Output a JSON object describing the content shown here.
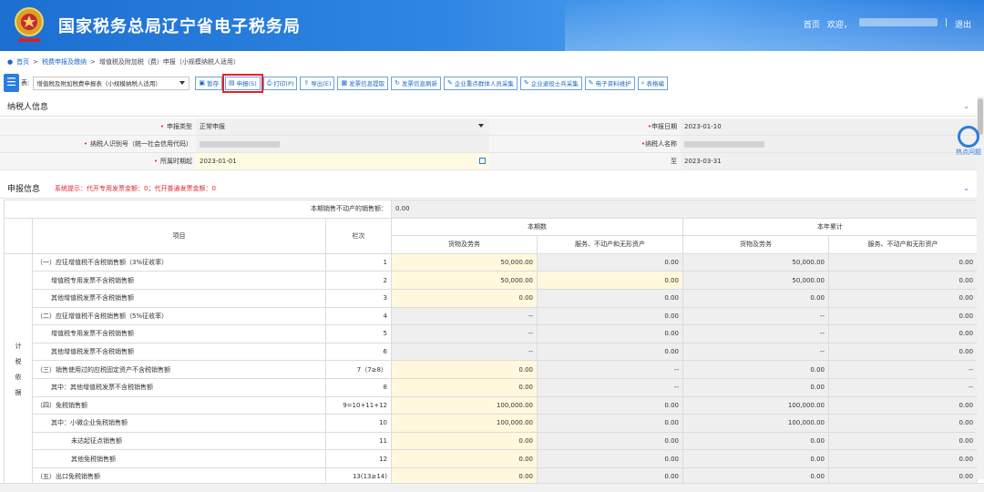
{
  "header": {
    "title": "国家税务总局辽宁省电子税务局",
    "nav": [
      "首页",
      "欢迎，",
      "|",
      "退出"
    ]
  },
  "breadcrumb": [
    "首页",
    "税费申报及缴纳",
    "增值税及附加税（费）申报（小规模纳税人适用）"
  ],
  "toolbar": {
    "label": "表:",
    "select_value": "增值税及附加税费申报表（小规模纳税人适用）",
    "buttons": [
      "暂存",
      "申报(S)",
      "打印(P)",
      "导出(E)",
      "发票信息提取",
      "发票信息刷新",
      "企业重点群体人员采集",
      "企业退役士兵采集",
      "电子资料维护",
      "表格编"
    ]
  },
  "taxpayer": {
    "title": "纳税人信息",
    "rows": [
      {
        "label": "申报类型",
        "value": "正常申报",
        "label2": "申报日期",
        "value2": "2023-01-10"
      },
      {
        "label": "纳税人识别号（统一社会信用代码）",
        "value": "",
        "label2": "纳税人名称",
        "value2": ""
      },
      {
        "label": "所属时期起",
        "value": "2023-01-01",
        "label2": "至",
        "value2": "2023-03-31"
      }
    ]
  },
  "declaration": {
    "title": "申报信息",
    "hint": "系统提示：代开专用发票金额：0；代开普通发票金额：0",
    "real_estate_label": "本期销售不动产的销售额：",
    "real_estate_value": "0.00",
    "side_label": "计税依据",
    "headers": {
      "item": "项目",
      "col": "栏次",
      "current": "本期数",
      "ytd": "本年累计",
      "goods": "货物及劳务",
      "services": "服务、不动产和无形资产"
    },
    "rows": [
      {
        "item": "（一）应征增值税不含税销售额（3%征收率）",
        "col": "1",
        "v": [
          "50,000.00",
          "0.00",
          "50,000.00",
          "0.00"
        ],
        "indent": 0
      },
      {
        "item": "增值税专用发票不含税销售额",
        "col": "2",
        "v": [
          "50,000.00",
          "0.00",
          "50,000.00",
          "0.00"
        ],
        "indent": 1
      },
      {
        "item": "其他增值税发票不含税销售额",
        "col": "3",
        "v": [
          "0.00",
          "0.00",
          "0.00",
          "0.00"
        ],
        "indent": 1
      },
      {
        "item": "（二）应征增值税不含税销售额（5%征收率）",
        "col": "4",
        "v": [
          "--",
          "0.00",
          "--",
          "0.00"
        ],
        "indent": 0
      },
      {
        "item": "增值税专用发票不含税销售额",
        "col": "5",
        "v": [
          "--",
          "0.00",
          "--",
          "0.00"
        ],
        "indent": 1
      },
      {
        "item": "其他增值税发票不含税销售额",
        "col": "6",
        "v": [
          "--",
          "0.00",
          "--",
          "0.00"
        ],
        "indent": 1
      },
      {
        "item": "（三）销售使用过的应税固定资产不含税销售额",
        "col": "7（7≥8）",
        "v": [
          "0.00",
          "--",
          "0.00",
          "--"
        ],
        "indent": 0
      },
      {
        "item": "其中：其他增值税发票不含税销售额",
        "col": "8",
        "v": [
          "0.00",
          "--",
          "0.00",
          "--"
        ],
        "indent": 1
      },
      {
        "item": "（四）免税销售额",
        "col": "9=10+11+12",
        "v": [
          "100,000.00",
          "0.00",
          "100,000.00",
          "0.00"
        ],
        "indent": 0
      },
      {
        "item": "其中：小微企业免税销售额",
        "col": "10",
        "v": [
          "100,000.00",
          "0.00",
          "100,000.00",
          "0.00"
        ],
        "indent": 1
      },
      {
        "item": "未达起征点销售额",
        "col": "11",
        "v": [
          "0.00",
          "0.00",
          "0.00",
          "0.00"
        ],
        "indent": 2
      },
      {
        "item": "其他免税销售额",
        "col": "12",
        "v": [
          "0.00",
          "0.00",
          "0.00",
          "0.00"
        ],
        "indent": 2
      },
      {
        "item": "（五）出口免税销售额",
        "col": "13(13≥14)",
        "v": [
          "0.00",
          "0.00",
          "0.00",
          "0.00"
        ],
        "indent": 0
      }
    ]
  },
  "widget": {
    "label": "热点问题"
  },
  "colors": {
    "brand": "#1c6fd1",
    "alert": "#e0262b",
    "editable": "#fff8dc"
  }
}
